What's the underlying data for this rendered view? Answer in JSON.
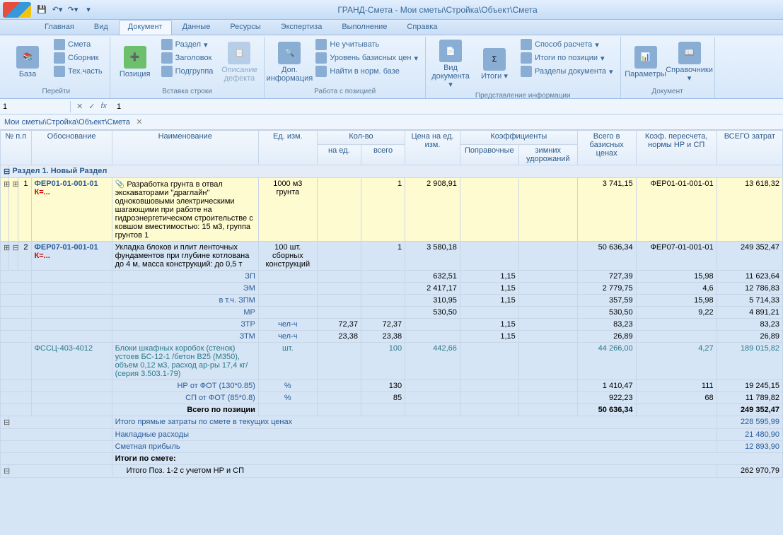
{
  "title": "ГРАНД-Смета - Мои сметы\\Стройка\\Объект\\Смета",
  "tabs": [
    "Главная",
    "Вид",
    "Документ",
    "Данные",
    "Ресурсы",
    "Экспертиза",
    "Выполнение",
    "Справка"
  ],
  "ribbon": {
    "g0": {
      "label": "Перейти",
      "baza": "База",
      "smeta": "Смета",
      "sbornik": "Сборник",
      "tech": "Тех.часть"
    },
    "g1": {
      "label": "Вставка строки",
      "poz": "Позиция",
      "razdel": "Раздел",
      "zag": "Заголовок",
      "podgr": "Подгруппа",
      "defect": "Описание дефекта"
    },
    "g2": {
      "label": "Работа с позицией",
      "dop": "Доп. информация",
      "ne": "Не учитывать",
      "uroven": "Уровень базисных цен",
      "naiti": "Найти в норм. базе"
    },
    "g3": {
      "label": "Представление информации",
      "vid": "Вид документа",
      "itogi": "Итоги",
      "sposob": "Способ расчета",
      "itogipoz": "Итоги по позиции",
      "razdely": "Разделы документа"
    },
    "g4": {
      "label": "Документ",
      "param": "Параметры",
      "sprav": "Справочники"
    }
  },
  "formula": {
    "cell": "1",
    "value": "1"
  },
  "breadcrumb": "Мои сметы\\Стройка\\Объект\\Смета",
  "headers": {
    "npp": "№ п.п",
    "obos": "Обоснование",
    "naim": "Наименование",
    "ed": "Ед. изм.",
    "kolvo": "Кол-во",
    "kolvo_ed": "на ед.",
    "kolvo_vsego": "всего",
    "cena": "Цена на ед. изм.",
    "koef": "Коэффициенты",
    "koef_pop": "Поправочные",
    "koef_zim": "зимних удорожаний",
    "baz": "Всего в базисных ценах",
    "peresch": "Коэф. пересчета, нормы НР и СП",
    "vsego": "ВСЕГО затрат"
  },
  "section": "Раздел 1. Новый Раздел",
  "rows": [
    {
      "n": "1",
      "code": "ФЕР01-01-001-01",
      "k": "К=...",
      "name": "Разработка грунта в отвал экскаваторами \"драглайн\" одноковшовыми электрическими шагающими при работе на гидроэнергетическом строительстве с ковшом вместимостью: 15 м3, группа грунтов 1",
      "ed": "1000 м3 грунта",
      "kolvo": "1",
      "cena": "2 908,91",
      "baz": "3 741,15",
      "peresch": "ФЕР01-01-001-01",
      "vsego": "13 618,32",
      "hl": true
    },
    {
      "n": "2",
      "code": "ФЕР07-01-001-01",
      "k": "К=...",
      "name": "Укладка блоков и плит ленточных фундаментов при глубине котлована до 4 м, масса конструкций: до 0,5 т",
      "ed": "100 шт. сборных конструкций",
      "kolvo": "1",
      "cena": "3 580,18",
      "baz": "50 636,34",
      "peresch": "ФЕР07-01-001-01",
      "vsego": "249 352,47"
    }
  ],
  "components": [
    {
      "label": "ЗП",
      "ed": "",
      "kolvo": "",
      "cena": "632,51",
      "pop": "1,15",
      "baz": "727,39",
      "per": "15,98",
      "vsego": "11 623,64"
    },
    {
      "label": "ЭМ",
      "ed": "",
      "kolvo": "",
      "cena": "2 417,17",
      "pop": "1,15",
      "baz": "2 779,75",
      "per": "4,6",
      "vsego": "12 786,83"
    },
    {
      "label": "в т.ч. ЗПМ",
      "ed": "",
      "kolvo": "",
      "cena": "310,95",
      "pop": "1,15",
      "baz": "357,59",
      "per": "15,98",
      "vsego": "5 714,33"
    },
    {
      "label": "МР",
      "ed": "",
      "kolvo": "",
      "cena": "530,50",
      "pop": "",
      "baz": "530,50",
      "per": "9,22",
      "vsego": "4 891,21"
    },
    {
      "label": "ЗТР",
      "ed": "чел-ч",
      "kolvo_ed": "72,37",
      "kolvo": "72,37",
      "cena": "",
      "pop": "1,15",
      "baz": "83,23",
      "per": "",
      "vsego": "83,23"
    },
    {
      "label": "ЗТМ",
      "ed": "чел-ч",
      "kolvo_ed": "23,38",
      "kolvo": "23,38",
      "cena": "",
      "pop": "1,15",
      "baz": "26,89",
      "per": "",
      "vsego": "26,89"
    }
  ],
  "material": {
    "code": "ФССЦ-403-4012",
    "name": "Блоки шкафных коробок (стенок) устоев БС-12-1 /бетон В25 (М350), объем 0,12 м3, расход ар-ры 17,4 кг/ (серия 3.503.1-79)",
    "ed": "шт.",
    "kolvo": "100",
    "cena": "442,66",
    "baz": "44 266,00",
    "per": "4,27",
    "vsego": "189 015,82"
  },
  "nr": {
    "label": "НР от ФОТ (130*0.85)",
    "ed": "%",
    "kolvo": "130",
    "baz": "1 410,47",
    "per": "111",
    "vsego": "19 245,15"
  },
  "sp": {
    "label": "СП от ФОТ (85*0.8)",
    "ed": "%",
    "kolvo": "85",
    "baz": "922,23",
    "per": "68",
    "vsego": "11 789,82"
  },
  "poz_total": {
    "label": "Всего по позиции",
    "baz": "50 636,34",
    "vsego": "249 352,47"
  },
  "summary": [
    {
      "label": "Итого прямые затраты по смете в текущих ценах",
      "val": "228 595,99"
    },
    {
      "label": "Накладные расходы",
      "val": "21 480,90"
    },
    {
      "label": "Сметная прибыль",
      "val": "12 893,90"
    }
  ],
  "itogi_label": "Итоги по смете:",
  "itogi_row": {
    "label": "Итого Поз. 1-2 с учетом НР и СП",
    "val": "262 970,79"
  }
}
